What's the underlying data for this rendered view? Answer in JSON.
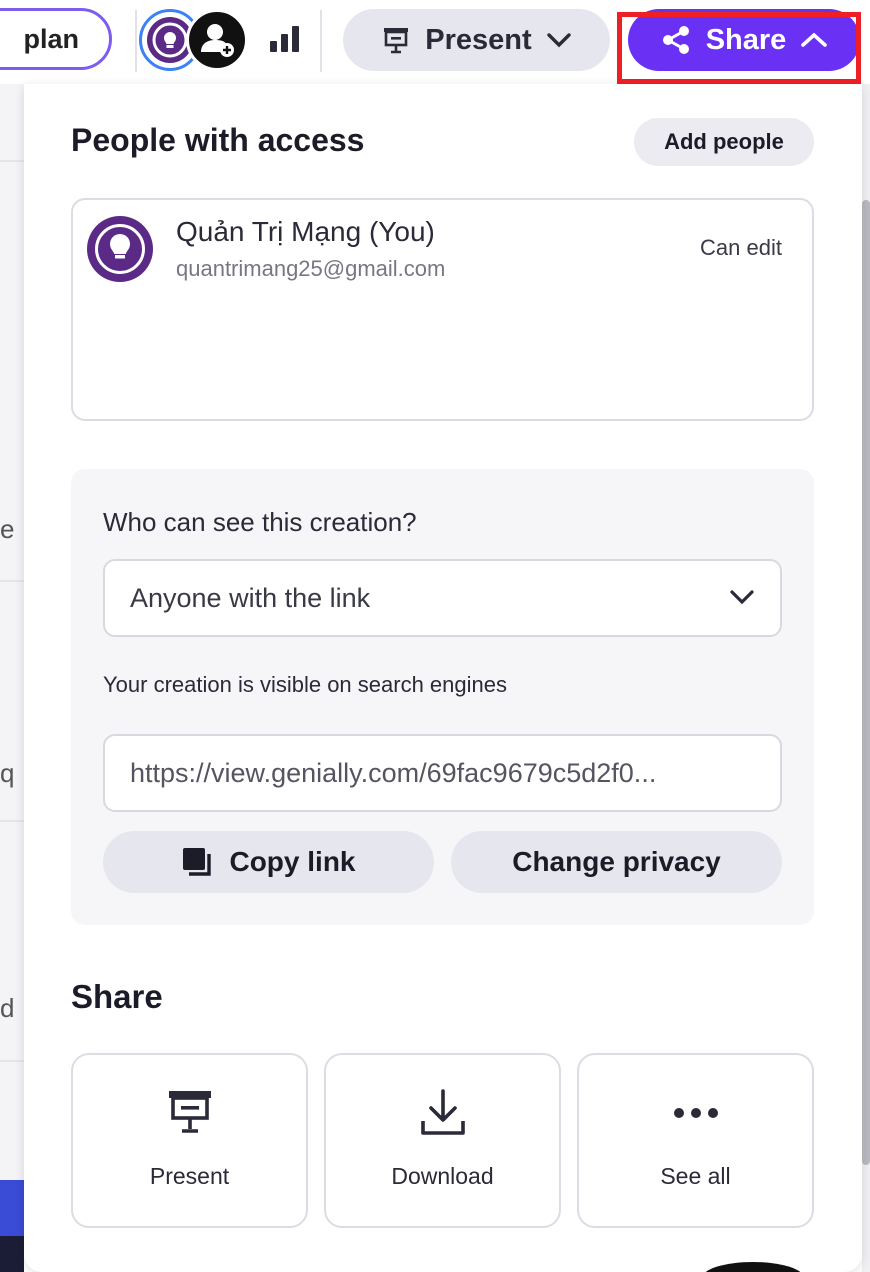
{
  "topbar": {
    "plan_label": "plan",
    "present_label": "Present",
    "share_label": "Share"
  },
  "access": {
    "title": "People with access",
    "add_people_label": "Add people",
    "user": {
      "name": "Quản Trị Mạng (You)",
      "email": "quantrimang25@gmail.com",
      "role": "Can edit"
    }
  },
  "privacy": {
    "question": "Who can see this creation?",
    "visibility_value": "Anyone with the link",
    "search_note": "Your creation is visible on search engines",
    "link_value": "https://view.genially.com/69fac9679c5d2f0...",
    "copy_label": "Copy link",
    "change_label": "Change privacy"
  },
  "share": {
    "title": "Share",
    "options": [
      {
        "label": "Present",
        "icon": "present-icon"
      },
      {
        "label": "Download",
        "icon": "download-icon"
      },
      {
        "label": "See all",
        "icon": "more-icon"
      }
    ]
  },
  "background_fragments": {
    "frag1": "e",
    "frag2": "q",
    "frag3": "d"
  },
  "colors": {
    "share_accent": "#6a31f5",
    "highlight": "#ef1f26",
    "avatar": "#5b2a86"
  }
}
